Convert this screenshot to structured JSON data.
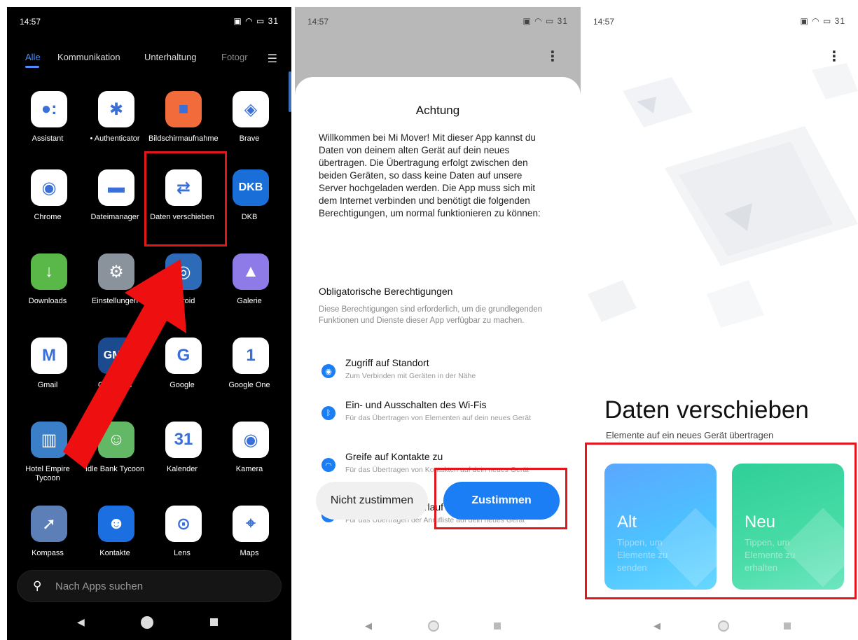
{
  "status_bar": {
    "time": "14:57",
    "icons_text": "▣ ◠ ▭ 31"
  },
  "launcher": {
    "tabs": [
      {
        "label": "Alle",
        "active": true
      },
      {
        "label": "Kommunikation",
        "active": false
      },
      {
        "label": "Unterhaltung",
        "active": false
      },
      {
        "label": "Fotogr",
        "active": false
      }
    ],
    "menu_icon": "hamburger-icon",
    "apps": [
      {
        "label": "Assistant",
        "icon": "assistant-icon",
        "color": "#ffffff",
        "glyph": "●:"
      },
      {
        "label": "• Authenticator",
        "icon": "authenticator-icon",
        "color": "#ffffff",
        "glyph": "✱"
      },
      {
        "label": "Bildschirmaufnahme",
        "icon": "screen-recorder-icon",
        "color": "#f26b3a",
        "glyph": "■"
      },
      {
        "label": "Brave",
        "icon": "brave-icon",
        "color": "#ffffff",
        "glyph": "◈"
      },
      {
        "label": "Chrome",
        "icon": "chrome-icon",
        "color": "#ffffff",
        "glyph": "◉"
      },
      {
        "label": "Dateimanager",
        "icon": "file-manager-icon",
        "color": "#ffffff",
        "glyph": "▬"
      },
      {
        "label": "Daten verschieben",
        "icon": "data-transfer-icon",
        "color": "#ffffff",
        "glyph": "⇄"
      },
      {
        "label": "DKB",
        "icon": "dkb-icon",
        "color": "#1a6ed8",
        "glyph": "DKB"
      },
      {
        "label": "Downloads",
        "icon": "downloads-icon",
        "color": "#59b847",
        "glyph": "↓"
      },
      {
        "label": "Einstellungen",
        "icon": "settings-icon",
        "color": "#8a939c",
        "glyph": "⚙"
      },
      {
        "label": "F-Droid",
        "icon": "fdroid-icon",
        "color": "#2d6bb8",
        "glyph": "◎"
      },
      {
        "label": "Galerie",
        "icon": "gallery-icon",
        "color": "#8e7be8",
        "glyph": "▲"
      },
      {
        "label": "Gmail",
        "icon": "gmail-icon",
        "color": "#ffffff",
        "glyph": "M"
      },
      {
        "label": "GMX Mail",
        "icon": "gmx-icon",
        "color": "#1c4a8f",
        "glyph": "GMX"
      },
      {
        "label": "Google",
        "icon": "google-icon",
        "color": "#ffffff",
        "glyph": "G"
      },
      {
        "label": "Google One",
        "icon": "google-one-icon",
        "color": "#ffffff",
        "glyph": "1"
      },
      {
        "label": "Hotel Empire Tycoon",
        "icon": "hotel-empire-icon",
        "color": "#3a7fc8",
        "glyph": "▥"
      },
      {
        "label": "Idle Bank Tycoon",
        "icon": "idle-bank-icon",
        "color": "#62b864",
        "glyph": "☺"
      },
      {
        "label": "Kalender",
        "icon": "calendar-icon",
        "color": "#ffffff",
        "glyph": "31"
      },
      {
        "label": "Kamera",
        "icon": "camera-icon",
        "color": "#ffffff",
        "glyph": "◉"
      },
      {
        "label": "Kompass",
        "icon": "compass-icon",
        "color": "#5b7fb6",
        "glyph": "➚"
      },
      {
        "label": "Kontakte",
        "icon": "contacts-icon",
        "color": "#1b6fe0",
        "glyph": "☻"
      },
      {
        "label": "Lens",
        "icon": "lens-icon",
        "color": "#ffffff",
        "glyph": "⊙"
      },
      {
        "label": "Maps",
        "icon": "maps-icon",
        "color": "#ffffff",
        "glyph": "⌖"
      }
    ],
    "search_placeholder": "Nach Apps suchen"
  },
  "consent": {
    "title": "Achtung",
    "intro": "Willkommen bei Mi Mover! Mit dieser App kannst du Daten von deinem alten Gerät auf dein neues übertragen. Die Übertragung erfolgt zwischen den beiden Geräten, so dass keine Daten auf unsere Server hochgeladen werden. Die App muss sich mit dem Internet verbinden und benötigt die folgenden Berechtigungen, um normal funktionieren zu können:",
    "section_title": "Obligatorische Berechtigungen",
    "section_desc": "Diese Berechtigungen sind erforderlich, um die grundlegenden Funktionen und Dienste dieser App verfügbar zu machen.",
    "permissions": [
      {
        "title": "Zugriff auf Standort",
        "desc": "Zum Verbinden mit Geräten in der Nähe",
        "icon": "location-icon",
        "glyph": "◉"
      },
      {
        "title": "Ein- und Ausschalten des Wi-Fis",
        "desc": "Für das Übertragen von Elementen auf dein neues Gerät",
        "icon": "bluetooth-icon",
        "glyph": "ᛒ"
      },
      {
        "title": "Greife auf Kontakte zu",
        "desc": "Für das Übertragen von Kontakten auf dein neues Gerät",
        "icon": "wifi-icon",
        "glyph": "◠"
      },
      {
        "title": "Greife auf Anrufverlauf zu",
        "desc": "Für das Übertragen der Anrufliste auf dein neues Gerät",
        "icon": "contacts-icon",
        "glyph": "☻"
      }
    ],
    "decline_label": "Nicht zustimmen",
    "accept_label": "Zustimmen"
  },
  "mover": {
    "title": "Daten verschieben",
    "subtitle": "Elemente auf ein neues Gerät übertragen",
    "cards": [
      {
        "title": "Alt",
        "desc": "Tippen, um Elemente zu senden"
      },
      {
        "title": "Neu",
        "desc": "Tippen, um Elemente zu erhalten"
      }
    ]
  },
  "colors": {
    "accent": "#1b7ef5",
    "highlight": "#e3171b",
    "tab_active": "#4c8dff"
  }
}
